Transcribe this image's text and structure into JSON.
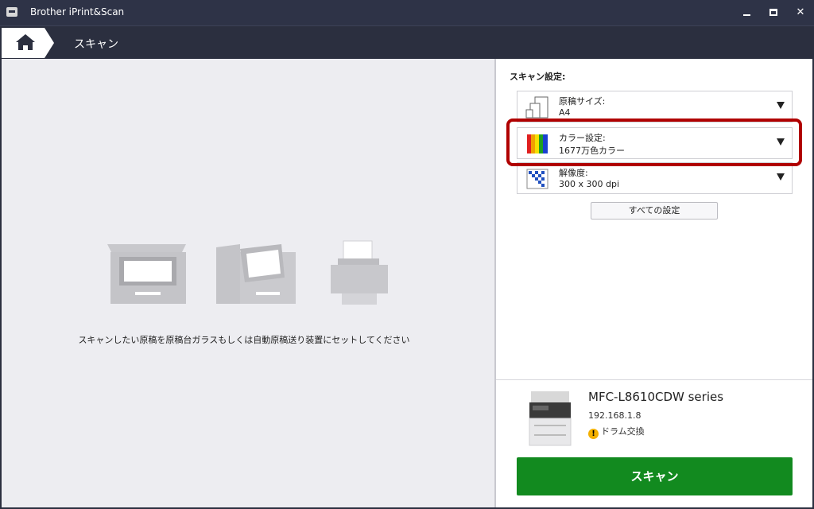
{
  "window": {
    "title": "Brother iPrint&Scan"
  },
  "nav": {
    "title": "スキャン"
  },
  "main": {
    "instruction": "スキャンしたい原稿を原稿台ガラスもしくは自動原稿送り装置にセットしてください"
  },
  "settings": {
    "label": "スキャン設定:",
    "items": [
      {
        "name": "原稿サイズ:",
        "value": "A4",
        "icon": "page-size-icon"
      },
      {
        "name": "カラー設定:",
        "value": "1677万色カラー",
        "icon": "color-bars-icon"
      },
      {
        "name": "解像度:",
        "value": "300 x 300 dpi",
        "icon": "resolution-icon"
      }
    ],
    "all_settings_label": "すべての設定"
  },
  "device": {
    "name": "MFC-L8610CDW series",
    "ip": "192.168.1.8",
    "status": "ドラム交換"
  },
  "scan_button_label": "スキャン",
  "colors": {
    "accent_green": "#128a1f",
    "highlight_red": "#b00000",
    "titlebar": "#2e3347"
  }
}
